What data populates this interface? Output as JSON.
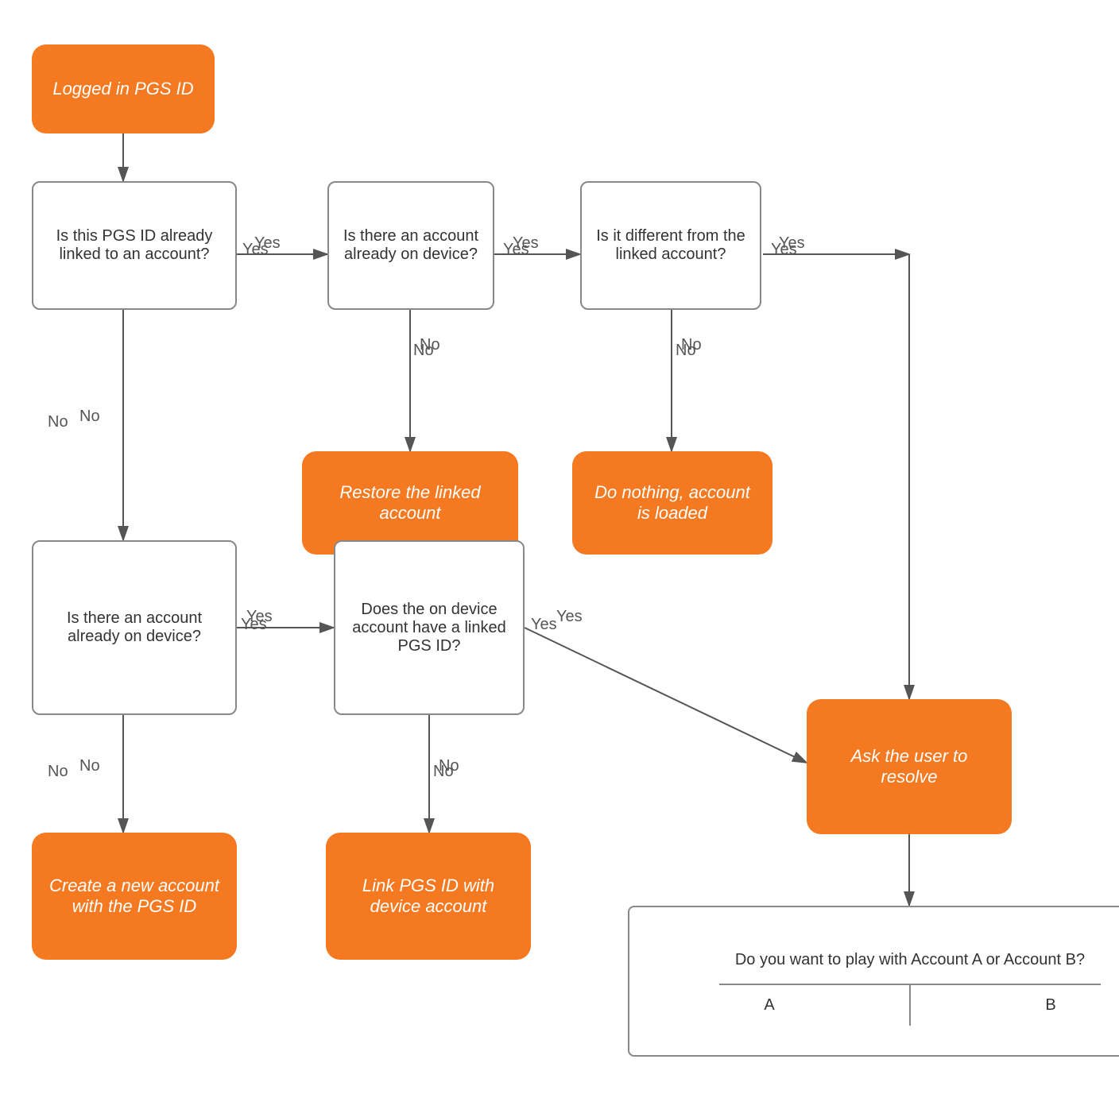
{
  "nodes": {
    "start": {
      "label": "Logged in PGS ID"
    },
    "q1": {
      "label": "Is this PGS ID already linked to an account?"
    },
    "q2": {
      "label": "Is there an account already on device?"
    },
    "q3": {
      "label": "Is it different from the linked account?"
    },
    "restore": {
      "label": "Restore the linked account"
    },
    "doNothing": {
      "label": "Do nothing, account is loaded"
    },
    "askResolve": {
      "label": "Ask the user to resolve"
    },
    "q4": {
      "label": "Is there an account already on device?"
    },
    "q5": {
      "label": "Does the on device account have a linked PGS ID?"
    },
    "createNew": {
      "label": "Create a new account with the PGS ID"
    },
    "linkPGS": {
      "label": "Link PGS ID with device account"
    },
    "dialogTop": {
      "label": "Do you want to play with Account A or Account B?"
    },
    "dialogA": {
      "label": "A"
    },
    "dialogB": {
      "label": "B"
    }
  },
  "labels": {
    "yes": "Yes",
    "no": "No"
  }
}
